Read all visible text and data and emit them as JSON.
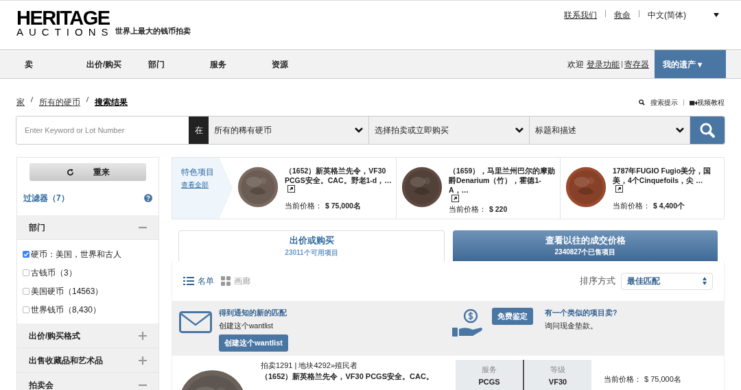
{
  "header": {
    "logo_top": "HERITAGE",
    "logo_bottom": "AUCTIONS",
    "tagline": "世界上最大的钱币拍卖",
    "links": [
      "联系我们",
      "救命"
    ],
    "language": "中文(简体)"
  },
  "nav": {
    "items": [
      "卖",
      "出价/购买",
      "部门",
      "服务",
      "资源"
    ],
    "welcome": "欢迎",
    "login": "登录功能",
    "register": "寄存器",
    "account": "我的遗产 ▾"
  },
  "breadcrumb": [
    {
      "label": "家",
      "current": false
    },
    {
      "label": "所有的硬币",
      "current": false
    },
    {
      "label": "搜索结果",
      "current": true
    }
  ],
  "help_links": [
    "搜索提示",
    "视频教程"
  ],
  "search": {
    "placeholder": "Enter Keyword or Lot Number",
    "in_label": "在",
    "selects": [
      "所有的稀有硬币",
      "选择拍卖或立即购买",
      "标题和描述"
    ]
  },
  "sidebar": {
    "reset": "重来",
    "filters": "过滤器（7）",
    "sections": [
      {
        "title": "部门",
        "expanded": true,
        "options": [
          {
            "label": "硬币：美国，世界和古人",
            "checked": true
          },
          {
            "label": "古钱币（3）",
            "checked": false
          },
          {
            "label": "美国硬币（14563）",
            "checked": false
          },
          {
            "label": "世界钱币（8,430）",
            "checked": false
          }
        ]
      },
      {
        "title": "出价/购买格式",
        "expanded": false
      },
      {
        "title": "出售收藏品和艺术品",
        "expanded": false
      },
      {
        "title": "拍卖会",
        "expanded": true
      }
    ]
  },
  "featured": {
    "title": "特色项目",
    "view_all": "查看全部",
    "items": [
      {
        "title": "（1652）新英格兰先令，VF30 PCGS安全。CAC。野老1-d，…",
        "price_label": "当前价格：",
        "price": "$ 75,000名",
        "color": "#7a6a60"
      },
      {
        "title": "（1659），马里兰州巴尔的摩勋爵Denarium（竹），霍德1-A，…",
        "price_label": "当前价格：",
        "price": "$ 220",
        "color": "#5e4a40"
      },
      {
        "title": "1787年FUGIO Fugio美分，国美，4个Cinquefoils，尖 …",
        "price_label": "当前价格：",
        "price": "$ 4,400个",
        "color": "#9a4a2e"
      }
    ]
  },
  "tabs": [
    {
      "title": "出价或购买",
      "subtitle": "23011个可用项目",
      "selected": true
    },
    {
      "title": "查看以往的成交价格",
      "subtitle": "2340827个已售项目",
      "selected": false
    }
  ],
  "views": [
    {
      "label": "名单",
      "selected": true
    },
    {
      "label": "画廊",
      "selected": false
    }
  ],
  "sort": {
    "label": "排序方式",
    "value": "最佳匹配"
  },
  "promo": {
    "alert_title": "得到通知的新的匹配",
    "alert_text": "创建这个wantlist",
    "alert_button": "创建这个wantlist",
    "appraisal_button": "免费鉴定",
    "sell_title": "有一个类似的项目卖?",
    "sell_text": "询问现金垫款。"
  },
  "lot": {
    "meta": "拍卖1291 | 地块4292»殖民者",
    "title": "（1652）新英格兰先令，VF30 PCGS安全。CAC。",
    "grade_headers": [
      "服务",
      "等级"
    ],
    "grade_values": [
      "PCGS",
      "VF30"
    ],
    "price_label": "当前价格：",
    "price": "$ 75,000名"
  }
}
